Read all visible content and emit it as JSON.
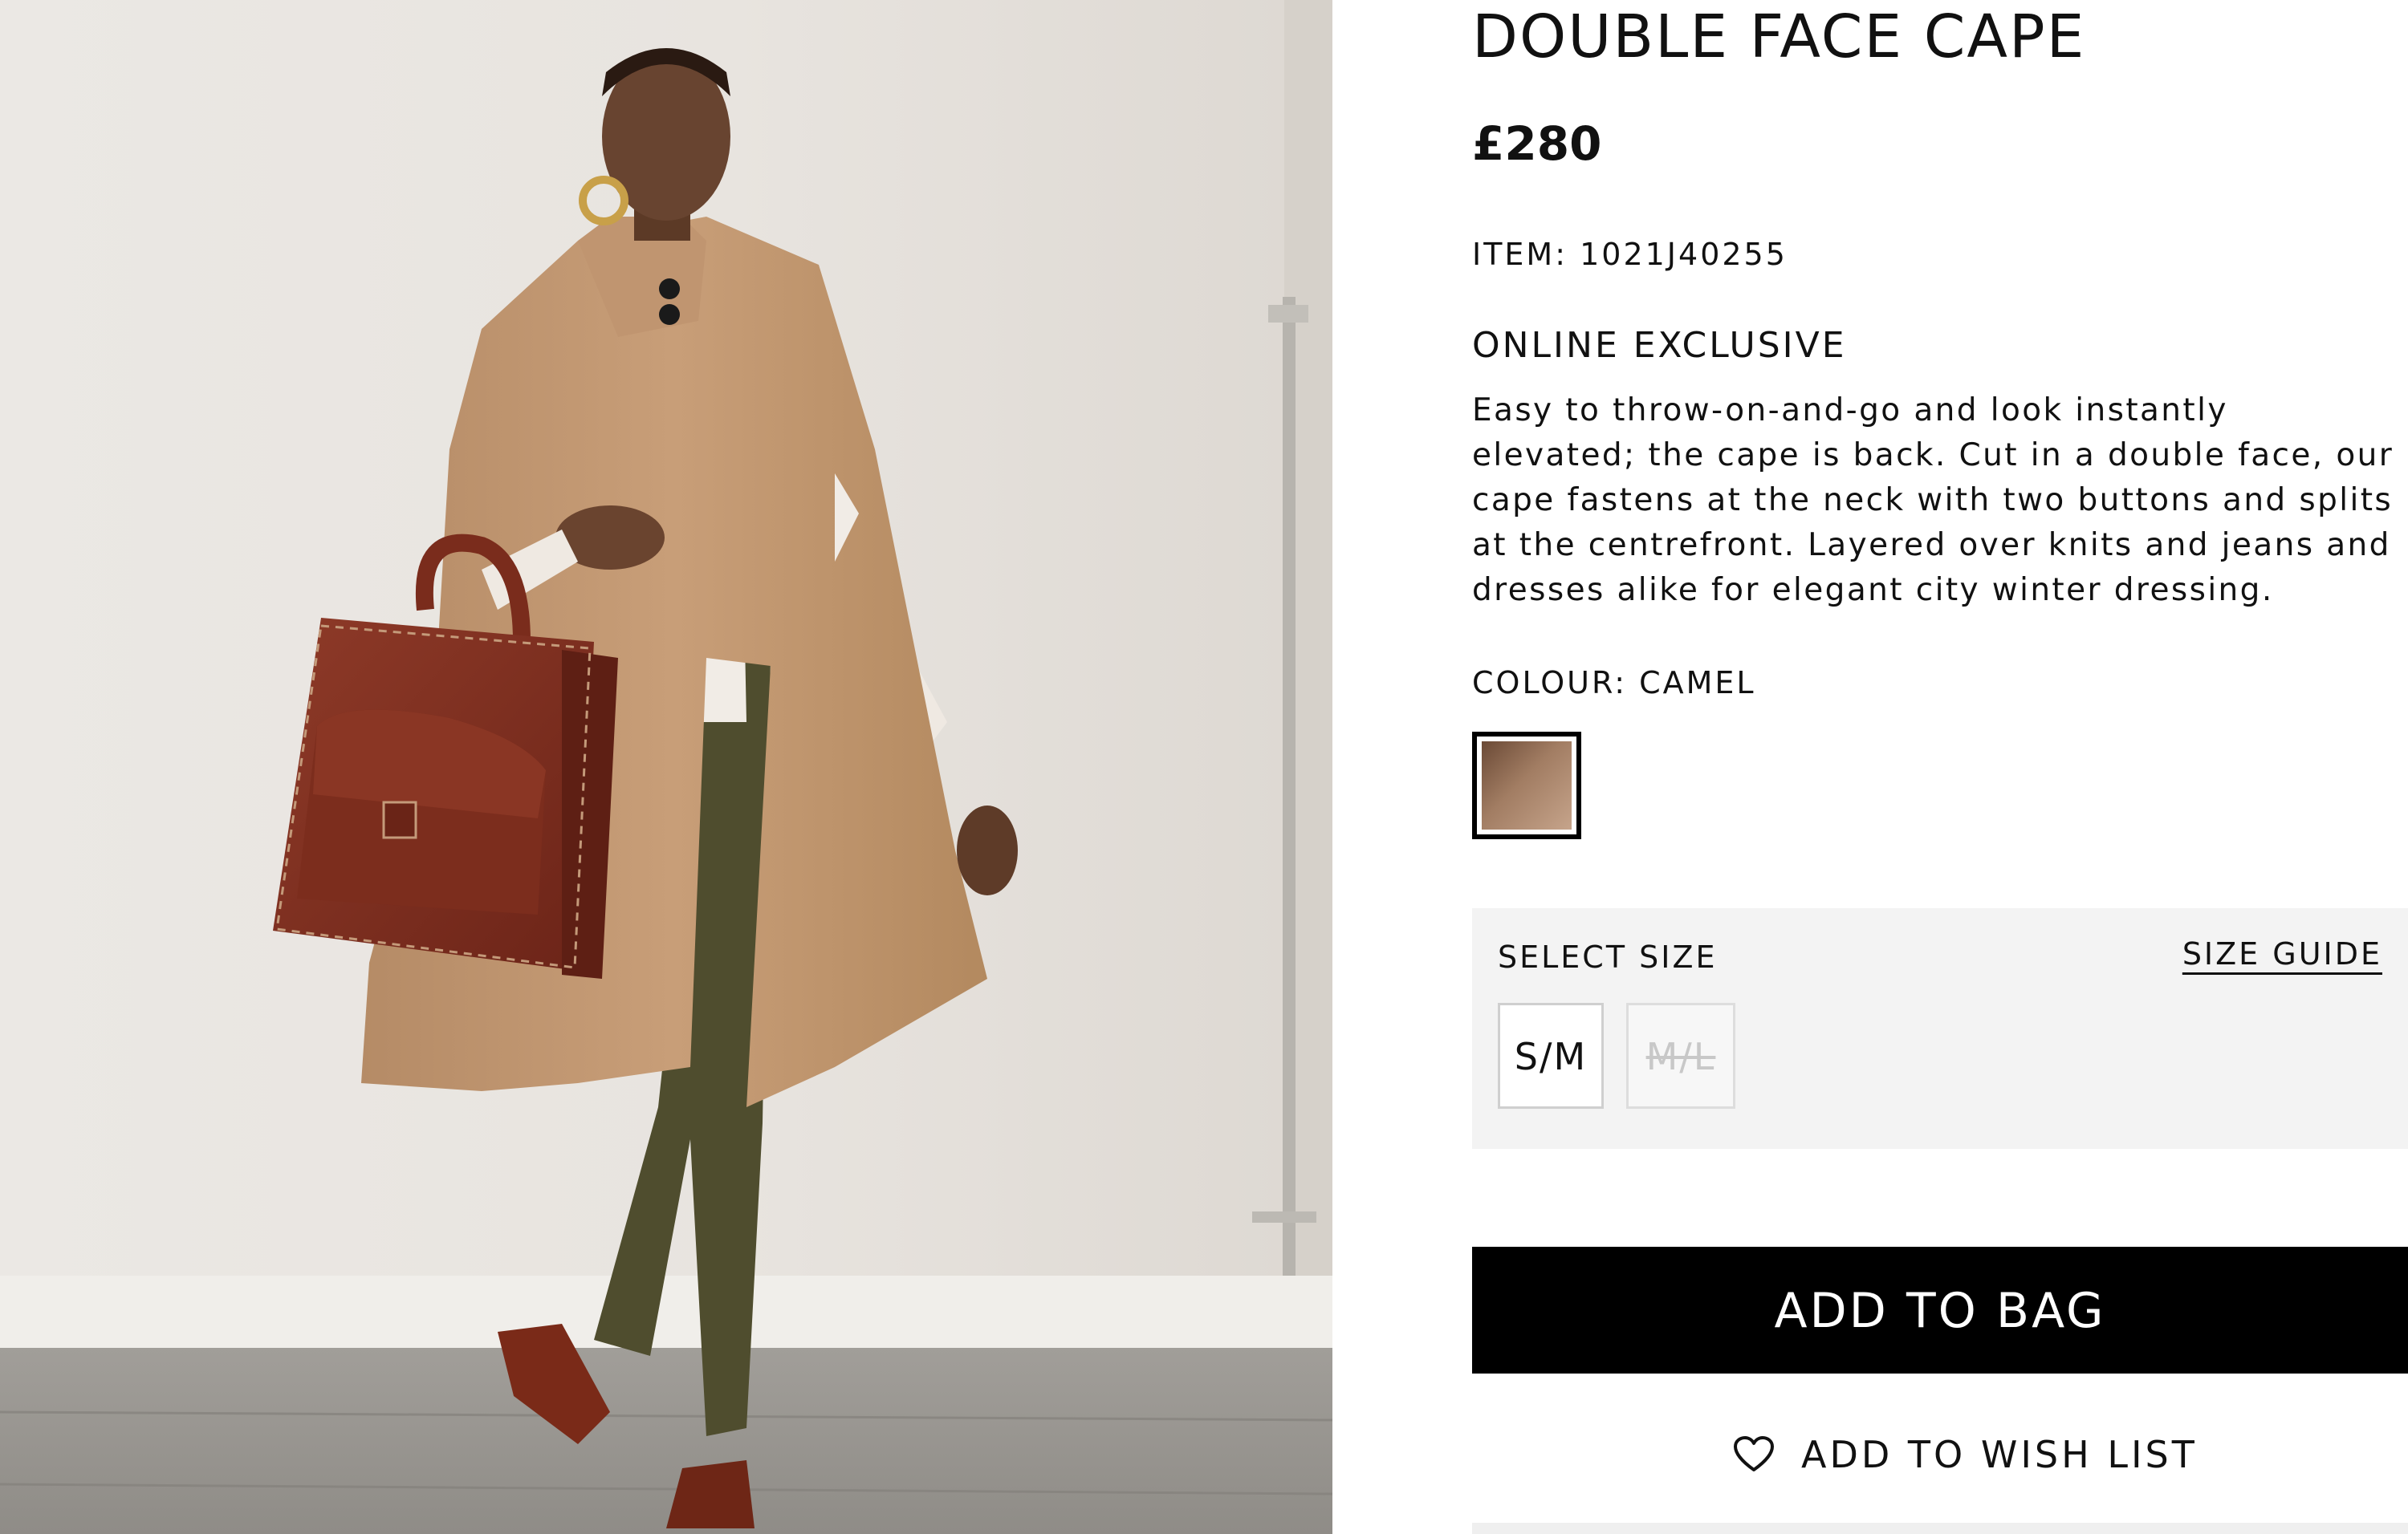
{
  "product": {
    "title": "DOUBLE FACE CAPE",
    "price": "£280",
    "item_label": "ITEM: 1021J40255",
    "badge": "ONLINE EXCLUSIVE",
    "description": "Easy to throw-on-and-go and look instantly elevated; the cape is back. Cut in a double face, our cape fastens at the neck with two buttons and splits at the centrefront. Layered over knits and jeans and dresses alike for elegant city winter dressing."
  },
  "colour": {
    "label": "COLOUR: CAMEL",
    "swatch_color": "#a27d63"
  },
  "size": {
    "label": "SELECT SIZE",
    "guide_label": "SIZE GUIDE",
    "options": [
      {
        "label": "S/M",
        "available": true
      },
      {
        "label": "M/L",
        "available": false
      }
    ]
  },
  "actions": {
    "add_to_bag": "ADD TO BAG",
    "add_to_wish_list": "ADD TO WISH LIST",
    "wish_icon": "heart-icon"
  },
  "colors": {
    "primary_button": "#000000",
    "panel_background": "#f3f3f3",
    "text": "#111111"
  }
}
